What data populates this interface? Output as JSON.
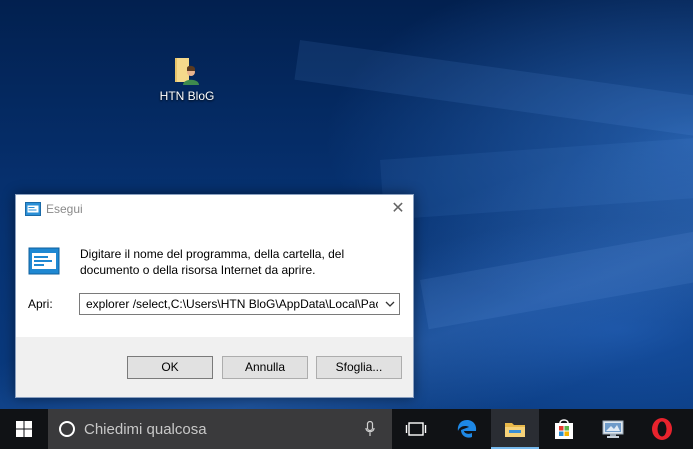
{
  "desktop": {
    "icon_label": "HTN BloG"
  },
  "run_dialog": {
    "title": "Esegui",
    "message": "Digitare il nome del programma, della cartella, del documento o della risorsa Internet da aprire.",
    "open_label": "Apri:",
    "command_value": "explorer /select,C:\\Users\\HTN BloG\\AppData\\Local\\Pac",
    "ok_label": "OK",
    "cancel_label": "Annulla",
    "browse_label": "Sfoglia..."
  },
  "taskbar": {
    "search_placeholder": "Chiedimi qualcosa",
    "items": [
      {
        "icon": "task-view-icon"
      },
      {
        "icon": "edge-icon"
      },
      {
        "icon": "file-explorer-icon"
      },
      {
        "icon": "store-icon"
      },
      {
        "icon": "remote-desktop-icon"
      },
      {
        "icon": "opera-icon"
      }
    ]
  },
  "colors": {
    "taskbar_bg": "#101215",
    "search_bg": "#3a3a3c",
    "accent": "#76b9ed",
    "dialog_footer": "#f0f0f0"
  }
}
